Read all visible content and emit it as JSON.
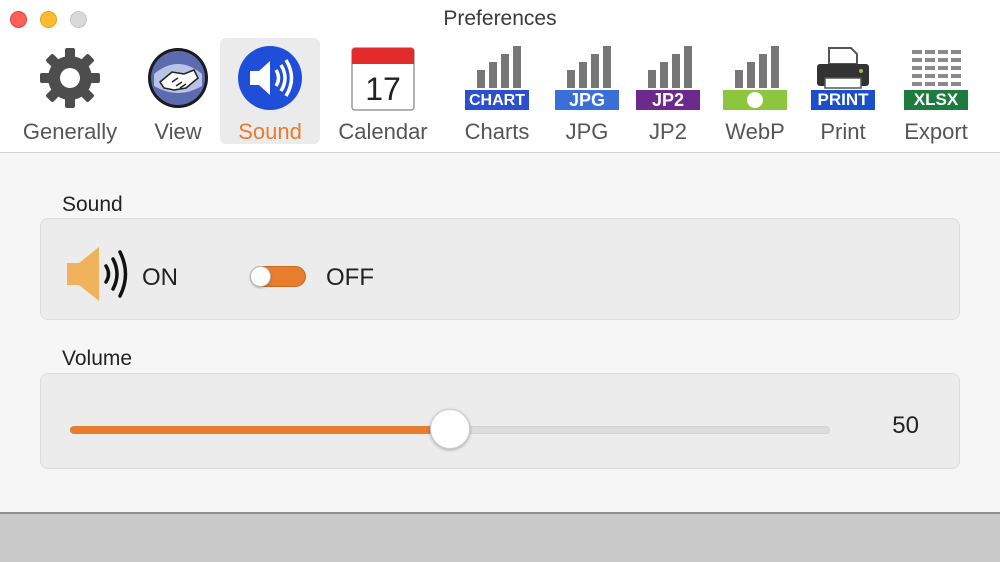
{
  "window": {
    "title": "Preferences"
  },
  "toolbar": {
    "items": [
      {
        "label": "Generally",
        "icon": "gear-icon"
      },
      {
        "label": "View",
        "icon": "handshake-icon"
      },
      {
        "label": "Sound",
        "icon": "speaker-icon",
        "selected": true
      },
      {
        "label": "Calendar",
        "icon": "calendar-icon",
        "badge": "17"
      },
      {
        "label": "Charts",
        "icon": "chart-icon",
        "badge": "CHART"
      },
      {
        "label": "JPG",
        "icon": "jpg-icon",
        "badge": "JPG"
      },
      {
        "label": "JP2",
        "icon": "jp2-icon",
        "badge": "JP2"
      },
      {
        "label": "WebP",
        "icon": "webp-icon"
      },
      {
        "label": "Print",
        "icon": "printer-icon",
        "badge": "PRINT"
      },
      {
        "label": "Export",
        "icon": "xlsx-icon",
        "badge": "XLSX"
      }
    ]
  },
  "sound": {
    "section_label": "Sound",
    "on_label": "ON",
    "off_label": "OFF",
    "toggle_state": "off"
  },
  "volume": {
    "section_label": "Volume",
    "value": "50",
    "fraction": 0.5
  },
  "colors": {
    "accent": "#e87d2e",
    "selected_bg": "#ebebeb",
    "chart_blue": "#2b4fcf",
    "jpg_blue": "#3a6fd8",
    "jp2_purple": "#6b2a8c",
    "webp_green": "#8cc63e",
    "print_blue": "#1a4fc9",
    "xlsx_green": "#1e7a3e"
  }
}
